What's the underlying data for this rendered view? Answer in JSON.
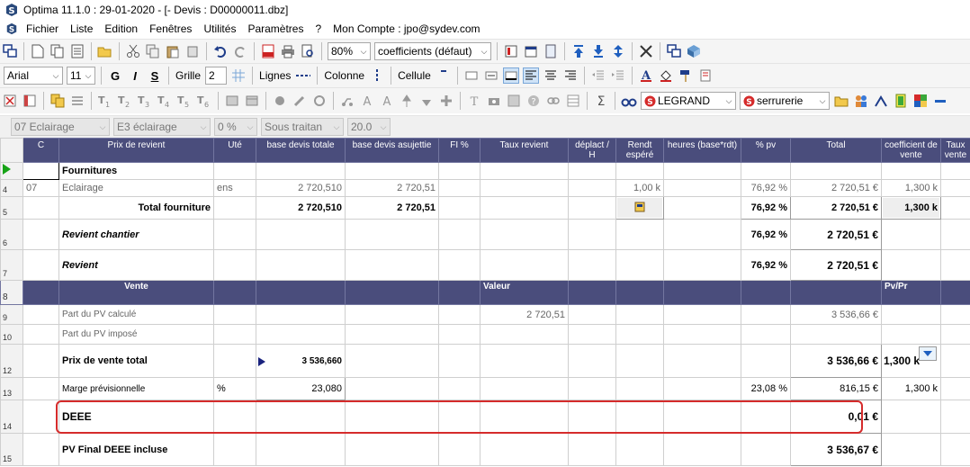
{
  "window": {
    "title": "Optima 11.1.0 : 29-01-2020 - [- Devis : D00000011.dbz]"
  },
  "menu": {
    "items": [
      "Fichier",
      "Liste",
      "Edition",
      "Fenêtres",
      "Utilités",
      "Paramètres",
      "?",
      "Mon Compte : jpo@sydev.com"
    ]
  },
  "toolbar1": {
    "zoom": "80%",
    "view_select": "coefficients (défaut)"
  },
  "toolbar2": {
    "font": "Arial",
    "size": "11",
    "bold": "G",
    "italic": "I",
    "strike": "S",
    "grille_label": "Grille",
    "grille_value": "2",
    "lignes_label": "Lignes",
    "colonne_label": "Colonne",
    "cellule_label": "Cellule"
  },
  "toolbar3": {
    "brand_select": "LEGRAND",
    "category_select": "serrurerie"
  },
  "toolbar4": {
    "f1": "07 Eclairage",
    "f2": "E3  éclairage",
    "f3": "0 %",
    "f4": "Sous traitan",
    "f5": "20.0"
  },
  "columns": [
    "C",
    "Prix de revient",
    "Uté",
    "base devis totale",
    "base devis asujettie",
    "FI %",
    "Taux revient",
    "déplact / H",
    "Rendt espéré",
    "heures (base*rdt)",
    "% pv",
    "Total",
    "coefficient de vente",
    "Taux vente"
  ],
  "rows": {
    "fournitures": {
      "label": "Fournitures"
    },
    "r4": {
      "num": "4",
      "code": "07",
      "label": "Eclairage",
      "ute": "ens",
      "base_totale": "2 720,510",
      "base_asujettie": "2 720,51",
      "rendt": "1,00 k",
      "pv": "76,92 %",
      "total": "2 720,51 €",
      "coef": "1,300 k"
    },
    "r5": {
      "num": "5",
      "label": "Total fourniture",
      "base_totale": "2 720,510",
      "base_asujettie": "2 720,51",
      "pv": "76,92 %",
      "total": "2 720,51 €",
      "coef": "1,300 k"
    },
    "r6": {
      "num": "6",
      "label": "Revient chantier",
      "pv": "76,92 %",
      "total": "2 720,51 €"
    },
    "r7": {
      "num": "7",
      "label": "Revient",
      "pv": "76,92 %",
      "total": "2 720,51 €"
    },
    "r8": {
      "num": "8",
      "label": "Vente",
      "valeur": "Valeur",
      "pvpr": "Pv/Pr"
    },
    "r9": {
      "num": "9",
      "label": "Part du PV calculé",
      "valeur": "2 720,51",
      "total": "3 536,66 €"
    },
    "r10": {
      "num": "10",
      "label": "Part du PV imposé"
    },
    "r12": {
      "num": "12",
      "label": "Prix de vente total",
      "base_totale": "3 536,660",
      "total": "3 536,66 €",
      "coef": "1,300 k"
    },
    "r13": {
      "num": "13",
      "label": "Marge prévisionnelle",
      "ute": "%",
      "base_totale": "23,080",
      "pv": "23,08 %",
      "total": "816,15 €",
      "coef": "1,300 k"
    },
    "r14": {
      "num": "14",
      "label": "DEEE",
      "total": "0,01 €"
    },
    "r15": {
      "num": "15",
      "label": "PV Final DEEE incluse",
      "total": "3 536,67 €"
    }
  },
  "colors": {
    "header_bg": "#4a4d7c",
    "highlight": "#d52b2b",
    "current_row_arrow": "#17a317"
  }
}
